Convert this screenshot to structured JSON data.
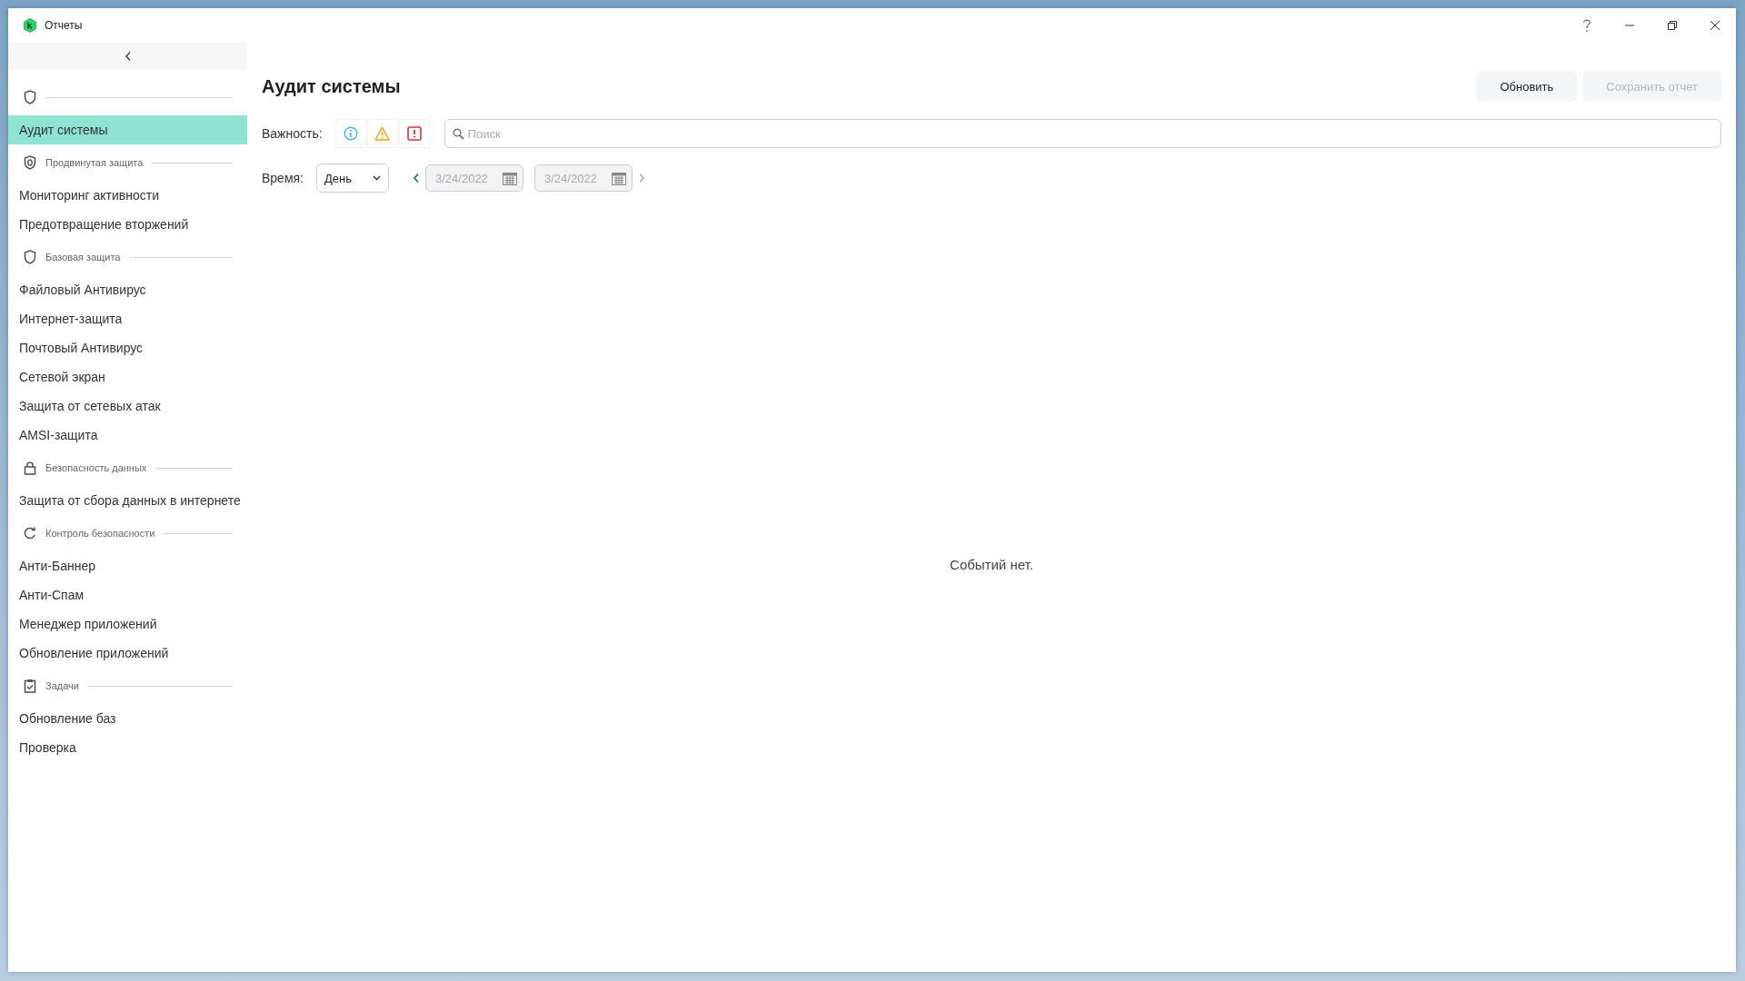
{
  "window": {
    "title": "Отчеты"
  },
  "sidebar": {
    "sections": [
      {
        "kind": "shield",
        "items": [
          {
            "label": "Аудит системы",
            "selected": true
          }
        ]
      },
      {
        "kind": "shield-badge",
        "label": "Продвинутая защита",
        "items": [
          {
            "label": "Мониторинг активности",
            "selected": false
          },
          {
            "label": "Предотвращение вторжений",
            "selected": false
          }
        ]
      },
      {
        "kind": "shield",
        "label": "Базовая защита",
        "items": [
          {
            "label": "Файловый Антивирус",
            "selected": false
          },
          {
            "label": "Интернет-защита",
            "selected": false
          },
          {
            "label": "Почтовый Антивирус",
            "selected": false
          },
          {
            "label": "Сетевой экран",
            "selected": false
          },
          {
            "label": "Защита от сетевых атак",
            "selected": false
          },
          {
            "label": "AMSI-защита",
            "selected": false
          }
        ]
      },
      {
        "kind": "lock",
        "label": "Безопасность данных",
        "items": [
          {
            "label": "Защита от сбора данных в интернете",
            "selected": false
          }
        ]
      },
      {
        "kind": "refresh",
        "label": "Контроль безопасности",
        "items": [
          {
            "label": "Анти-Баннер",
            "selected": false
          },
          {
            "label": "Анти-Спам",
            "selected": false
          },
          {
            "label": "Менеджер приложений",
            "selected": false
          },
          {
            "label": "Обновление приложений",
            "selected": false
          }
        ]
      },
      {
        "kind": "clipboard",
        "label": "Задачи",
        "items": [
          {
            "label": "Обновление баз",
            "selected": false
          },
          {
            "label": "Проверка",
            "selected": false
          }
        ]
      }
    ]
  },
  "page": {
    "title": "Аудит системы",
    "buttons": [
      {
        "label": "Обновить",
        "disabled": false
      },
      {
        "label": "Сохранить отчет",
        "disabled": true
      }
    ]
  },
  "severity": {
    "label": "Важность:",
    "levels": [
      {
        "kind": "info"
      },
      {
        "kind": "warning"
      },
      {
        "kind": "critical"
      }
    ]
  },
  "search": {
    "placeholder": "Поиск"
  },
  "time": {
    "label": "Время:",
    "period": "День",
    "from": "3/24/2022",
    "to": "3/24/2022",
    "dates_disabled": true
  },
  "empty_message": "Событий нет."
}
